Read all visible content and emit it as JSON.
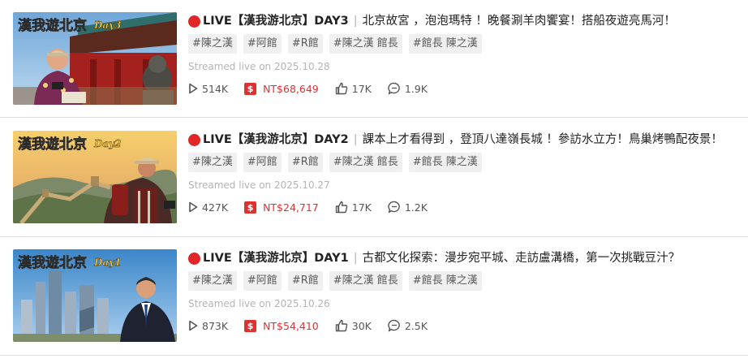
{
  "videos": [
    {
      "episode": "DAY3",
      "title_prefix": "LIVE【漢我游北京】DAY3",
      "title_desc": "北京故宮 ，泡泡瑪特 ！晚餐涮羊肉饗宴！搭船夜遊亮馬河！",
      "thumb_text": "漢我遊北京",
      "thumb_day": "Day3",
      "tags": [
        "#陳之漢",
        "#阿館",
        "#R館",
        "#陳之漢 館長",
        "#館長 陳之漢"
      ],
      "streamed": "Streamed live on 2025.10.28",
      "views": "514K",
      "donations": "NT$68,649",
      "likes": "17K",
      "comments": "1.9K"
    },
    {
      "episode": "DAY2",
      "title_prefix": "LIVE【漢我游北京】DAY2",
      "title_desc": "課本上才看得到 ，登頂八達嶺長城 ！參訪水立方！鳥巢烤鴨配夜景！",
      "thumb_text": "漢我遊北京",
      "thumb_day": "Day2",
      "tags": [
        "#陳之漢",
        "#阿館",
        "#R館",
        "#陳之漢 館長",
        "#館長 陳之漢"
      ],
      "streamed": "Streamed live on 2025.10.27",
      "views": "427K",
      "donations": "NT$24,717",
      "likes": "17K",
      "comments": "1.2K"
    },
    {
      "episode": "DAY1",
      "title_prefix": "LIVE【漢我游北京】DAY1",
      "title_desc": "古都文化探索：漫步宛平城、走訪盧溝橋，第一次挑戰豆汁？",
      "thumb_text": "漢我遊北京",
      "thumb_day": "Day1",
      "tags": [
        "#陳之漢",
        "#阿館",
        "#R館",
        "#陳之漢 館長",
        "#館長 陳之漢"
      ],
      "streamed": "Streamed live on 2025.10.26",
      "views": "873K",
      "donations": "NT$54,410",
      "likes": "30K",
      "comments": "2.5K"
    }
  ],
  "icons": {
    "live": "red-circle-icon",
    "views": "play-triangle-icon",
    "donations": "dollar-box-icon",
    "likes": "thumbs-up-icon",
    "comments": "speech-bubble-icon"
  },
  "colors": {
    "live_red": "#e02626",
    "donation_red": "#e03131",
    "tag_bg": "#f0f0f0",
    "meta_gray": "#b4b4b4"
  }
}
